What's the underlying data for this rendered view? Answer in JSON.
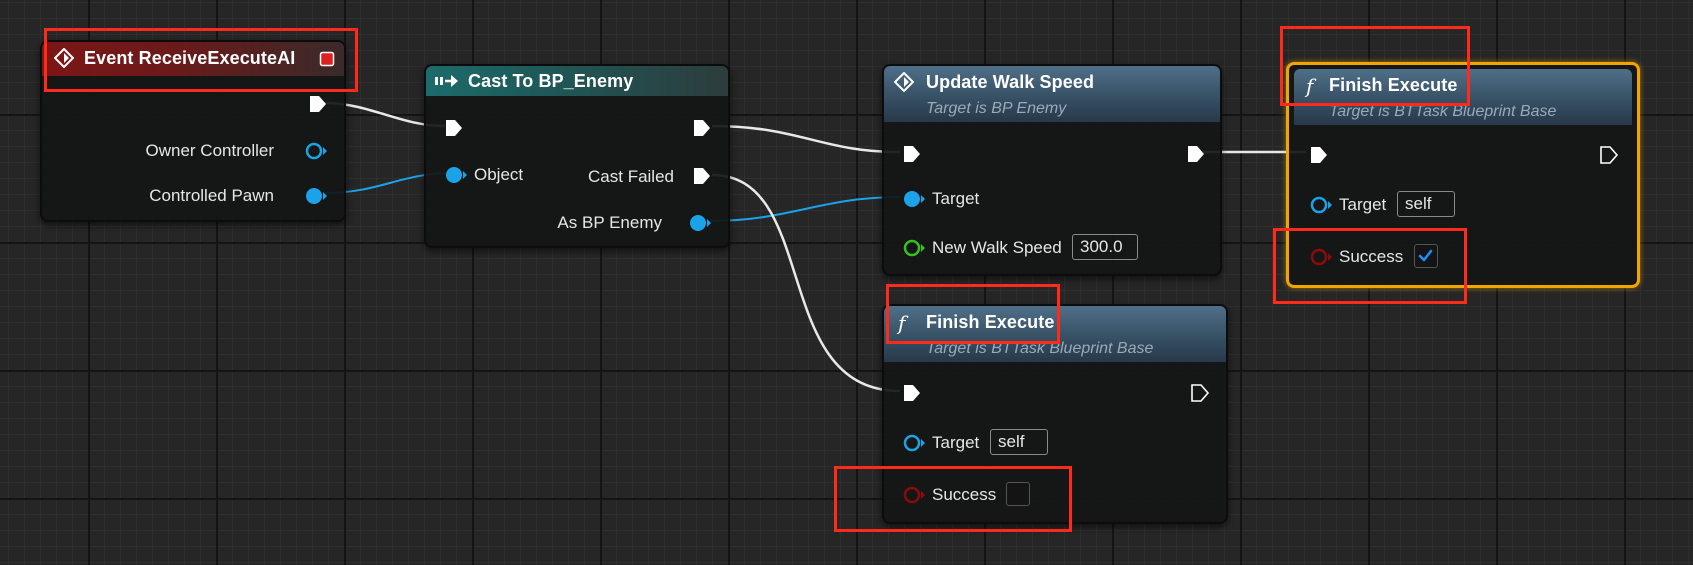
{
  "colors": {
    "exec": "#ffffff",
    "object_pin": "#1aa3e8",
    "float_pin": "#34c21c",
    "bool_pin": "#8c0c0c",
    "highlight": "#ff2a1a",
    "selected": "#f0a500"
  },
  "nodes": {
    "event": {
      "title": "Event ReceiveExecuteAI",
      "icon": "event-diamond-icon",
      "pins": {
        "owner_controller": "Owner Controller",
        "controlled_pawn": "Controlled Pawn"
      }
    },
    "cast": {
      "title": "Cast To BP_Enemy",
      "icon": "cast-arrow-icon",
      "pins": {
        "object": "Object",
        "cast_failed": "Cast Failed",
        "as_bp_enemy": "As BP Enemy"
      }
    },
    "update_walk_speed": {
      "title": "Update Walk Speed",
      "subtitle": "Target is BP Enemy",
      "icon": "function-diamond-icon",
      "pins": {
        "target": "Target",
        "new_walk_speed": "New Walk Speed"
      },
      "new_walk_speed_value": "300.0"
    },
    "finish_execute_success": {
      "title": "Finish Execute",
      "subtitle": "Target is BTTask Blueprint Base",
      "icon": "function-f-icon",
      "pins": {
        "target": "Target",
        "success": "Success"
      },
      "target_value": "self",
      "success_checked": true
    },
    "finish_execute_fail": {
      "title": "Finish Execute",
      "subtitle": "Target is BTTask Blueprint Base",
      "icon": "function-f-icon",
      "pins": {
        "target": "Target",
        "success": "Success"
      },
      "target_value": "self",
      "success_checked": false
    }
  }
}
